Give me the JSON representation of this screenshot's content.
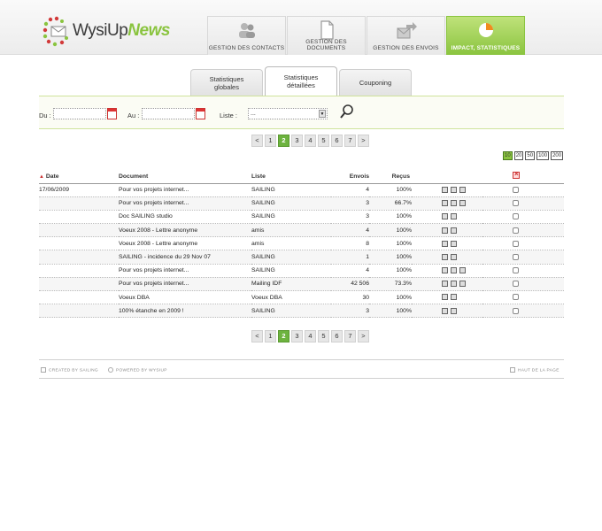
{
  "app": {
    "logo_text": "WysiUp",
    "logo_accent": "News",
    "accent_color": "#8ac43f"
  },
  "nav": [
    {
      "label": "Gestion des contacts",
      "icon": "contacts-icon",
      "active": false
    },
    {
      "label": "Gestion des documents",
      "icon": "document-icon",
      "active": false
    },
    {
      "label": "Gestion des envois",
      "icon": "send-icon",
      "active": false
    },
    {
      "label": "Impact, statistiques",
      "icon": "pie-chart-icon",
      "active": true
    }
  ],
  "subtabs": [
    "Statistiques globales",
    "Statistiques détaillées",
    "Couponing"
  ],
  "filter": {
    "from_label": "Du :",
    "to_label": "Au :",
    "list_label": "Liste :",
    "list_value": "..."
  },
  "pager": {
    "prev": "<",
    "pages": [
      "1",
      "2",
      "3",
      "4",
      "5",
      "6",
      "7"
    ],
    "current": "2",
    "next": ">"
  },
  "per_page": [
    "10",
    "20",
    "50",
    "100",
    "200"
  ],
  "table": {
    "headers": {
      "date": "Date",
      "doc": "Document",
      "list": "Liste",
      "sent": "Envois",
      "received": "Reçus"
    },
    "rows": [
      {
        "date": "17/06/2009",
        "doc": "Pour vos projets internet...",
        "list": "SAILING",
        "sent": "4",
        "received": "100%",
        "actions": 3
      },
      {
        "date": "",
        "doc": "Pour vos projets internet...",
        "list": "SAILING",
        "sent": "3",
        "received": "66.7%",
        "actions": 3
      },
      {
        "date": "",
        "doc": "Doc SAILING studio",
        "list": "SAILING",
        "sent": "3",
        "received": "100%",
        "actions": 2
      },
      {
        "date": "",
        "doc": "Voeux 2008 - Lettre anonyme",
        "list": "amis",
        "sent": "4",
        "received": "100%",
        "actions": 2
      },
      {
        "date": "",
        "doc": "Voeux 2008 - Lettre anonyme",
        "list": "amis",
        "sent": "8",
        "received": "100%",
        "actions": 2
      },
      {
        "date": "",
        "doc": "SAILING - incidence du 29 Nov 07",
        "list": "SAILING",
        "sent": "1",
        "received": "100%",
        "actions": 2
      },
      {
        "date": "",
        "doc": "Pour vos projets internet...",
        "list": "SAILING",
        "sent": "4",
        "received": "100%",
        "actions": 3
      },
      {
        "date": "",
        "doc": "Pour vos projets internet...",
        "list": "Mailing IDF",
        "sent": "42 506",
        "received": "73.3%",
        "actions": 3
      },
      {
        "date": "",
        "doc": "Voeux DBA",
        "list": "Voeux DBA",
        "sent": "30",
        "received": "100%",
        "actions": 2
      },
      {
        "date": "",
        "doc": "100% étanche en 2009 !",
        "list": "SAILING",
        "sent": "3",
        "received": "100%",
        "actions": 2
      }
    ]
  },
  "footer": {
    "created": "Created by Sailing",
    "powered": "Powered by WysiUp",
    "top": "Haut de la page"
  }
}
